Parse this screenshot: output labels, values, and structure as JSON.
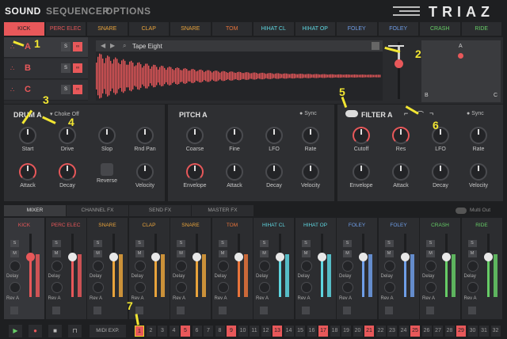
{
  "nav": {
    "tabs": [
      "SOUND",
      "SEQUENCER",
      "OPTIONS"
    ],
    "logo": "TRIAZ"
  },
  "instruments": [
    {
      "label": "KICK",
      "color": "#e8585a"
    },
    {
      "label": "PERC ELEC",
      "color": "#e8585a"
    },
    {
      "label": "SNARE",
      "color": "#e8a33b"
    },
    {
      "label": "CLAP",
      "color": "#e8a33b"
    },
    {
      "label": "SNARE",
      "color": "#e8a33b"
    },
    {
      "label": "TOM",
      "color": "#e8743b"
    },
    {
      "label": "HIHAT CL",
      "color": "#5ed6e0"
    },
    {
      "label": "HIHAT OP",
      "color": "#5ed6e0"
    },
    {
      "label": "FOLEY",
      "color": "#6f9ee8"
    },
    {
      "label": "FOLEY",
      "color": "#6f9ee8"
    },
    {
      "label": "CRASH",
      "color": "#66cc66"
    },
    {
      "label": "RIDE",
      "color": "#66cc66"
    }
  ],
  "layers": [
    {
      "letter": "A",
      "solo": "S"
    },
    {
      "letter": "B",
      "solo": "S"
    },
    {
      "letter": "C",
      "solo": "S"
    }
  ],
  "sample": {
    "name": "Tape Eight"
  },
  "xy_pad": {
    "a": "A",
    "b": "B",
    "c": "C"
  },
  "drum": {
    "title": "DRUM A",
    "choke": "Choke Off",
    "knobs": [
      "Start",
      "Drive",
      "Slop",
      "Rnd Pan",
      "Attack",
      "Decay",
      "Reverse",
      "Velocity"
    ]
  },
  "pitch": {
    "title": "PITCH A",
    "sync": "Sync",
    "knobs": [
      "Coarse",
      "Fine",
      "LFO",
      "Rate",
      "Envelope",
      "Attack",
      "Decay",
      "Velocity"
    ]
  },
  "filter": {
    "title": "FILTER A",
    "sync": "Sync",
    "knobs": [
      "Cutoff",
      "Res",
      "LFO",
      "Rate",
      "Envelope",
      "Attack",
      "Decay",
      "Velocity"
    ]
  },
  "mixer_tabs": [
    "MIXER",
    "CHANNEL FX",
    "SEND FX",
    "MASTER FX"
  ],
  "multi_out": "Multi Out",
  "channel_labels": {
    "solo": "S",
    "mute": "M",
    "delay": "Delay",
    "rev": "Rev A"
  },
  "transport": {
    "midi_exp": "MIDI EXP.",
    "steps": [
      "1",
      "2",
      "3",
      "4",
      "5",
      "6",
      "7",
      "8",
      "9",
      "10",
      "11",
      "12",
      "13",
      "14",
      "15",
      "16",
      "17",
      "18",
      "19",
      "20",
      "21",
      "22",
      "23",
      "24",
      "25",
      "26",
      "27",
      "28",
      "29",
      "30",
      "31",
      "32"
    ],
    "active_steps": [
      1,
      5,
      9,
      13,
      17,
      21,
      25,
      29
    ]
  },
  "annotations": [
    "1",
    "2",
    "3",
    "4",
    "5",
    "6",
    "7"
  ]
}
